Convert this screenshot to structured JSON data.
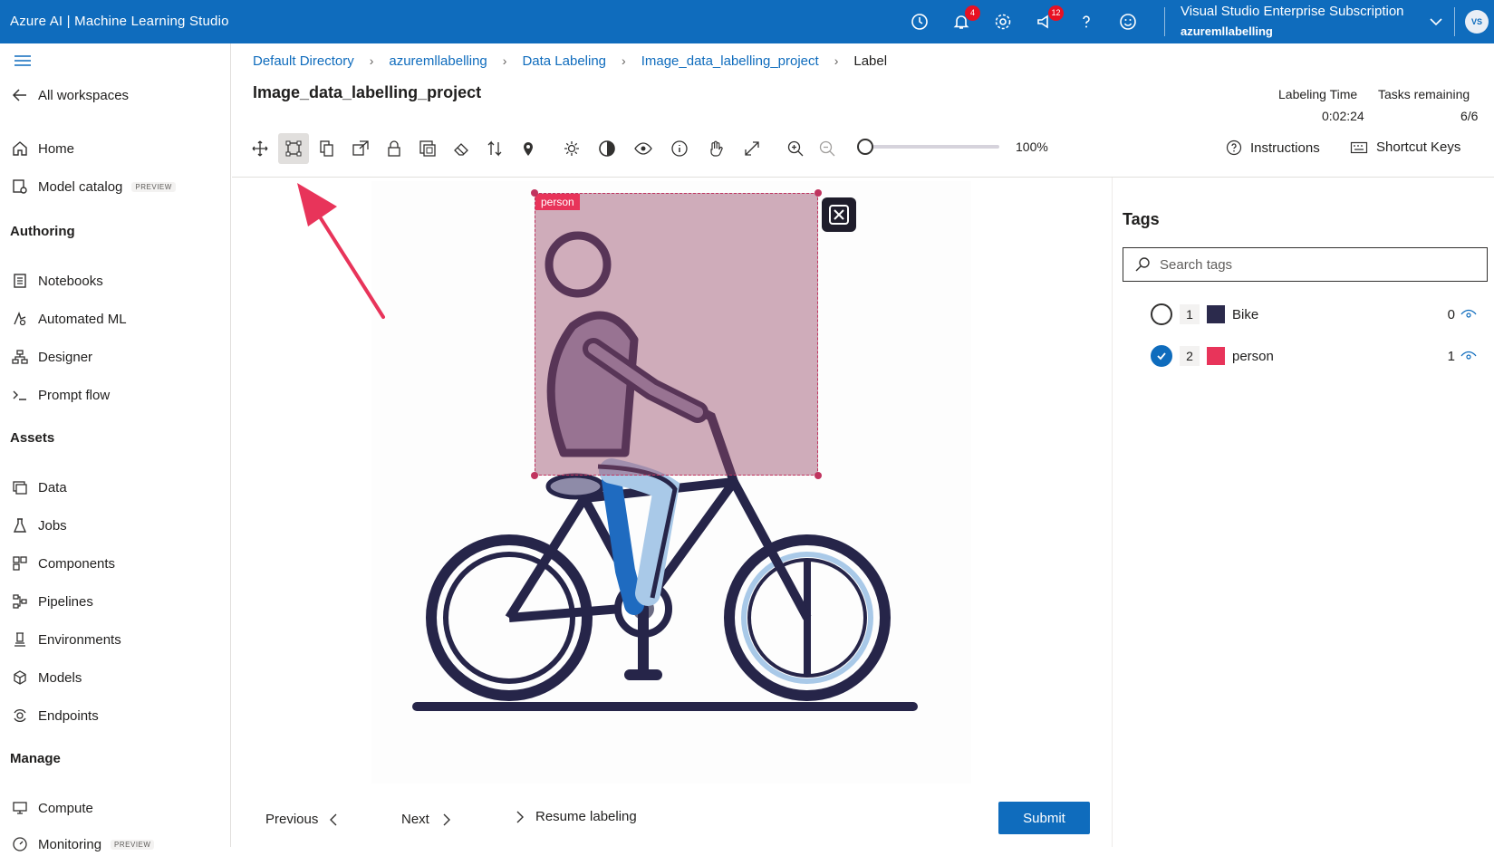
{
  "app": {
    "title": "Azure AI | Machine Learning Studio"
  },
  "topbar": {
    "notifications_badge": "4",
    "feedback_badge": "12",
    "subscription": "Visual Studio Enterprise Subscription",
    "workspace": "azuremllabelling",
    "avatar_initials": "VS"
  },
  "sidebar": {
    "all_workspaces": "All workspaces",
    "home": "Home",
    "model_catalog": "Model catalog",
    "preview_badge": "PREVIEW",
    "sections": {
      "authoring": "Authoring",
      "assets": "Assets",
      "manage": "Manage"
    },
    "authoring_items": [
      "Notebooks",
      "Automated ML",
      "Designer",
      "Prompt flow"
    ],
    "assets_items": [
      "Data",
      "Jobs",
      "Components",
      "Pipelines",
      "Environments",
      "Models",
      "Endpoints"
    ],
    "manage_items": [
      "Compute",
      "Monitoring"
    ]
  },
  "breadcrumb": [
    "Default Directory",
    "azuremllabelling",
    "Data Labeling",
    "Image_data_labelling_project",
    "Label"
  ],
  "project": {
    "title": "Image_data_labelling_project"
  },
  "stats": {
    "labeling_time_label": "Labeling Time",
    "labeling_time_value": "0:02:24",
    "tasks_remaining_label": "Tasks remaining",
    "tasks_remaining_value": "6/6"
  },
  "toolbar": {
    "zoom_value": "100%",
    "zoom_fraction": 0.0,
    "instructions": "Instructions",
    "shortcut_keys": "Shortcut Keys"
  },
  "annotation": {
    "label": "person"
  },
  "tags": {
    "title": "Tags",
    "search_placeholder": "Search tags",
    "items": [
      {
        "num": "1",
        "name": "Bike",
        "count": "0",
        "color": "#2b2a4c",
        "selected": false
      },
      {
        "num": "2",
        "name": "person",
        "count": "1",
        "color": "#e8345a",
        "selected": true
      }
    ]
  },
  "nav": {
    "previous": "Previous",
    "next": "Next",
    "resume": "Resume labeling",
    "submit": "Submit"
  },
  "colors": {
    "topbar": "#0f6cbd",
    "accent": "#0f6cbd",
    "annotation_arrow": "#e8345a"
  }
}
